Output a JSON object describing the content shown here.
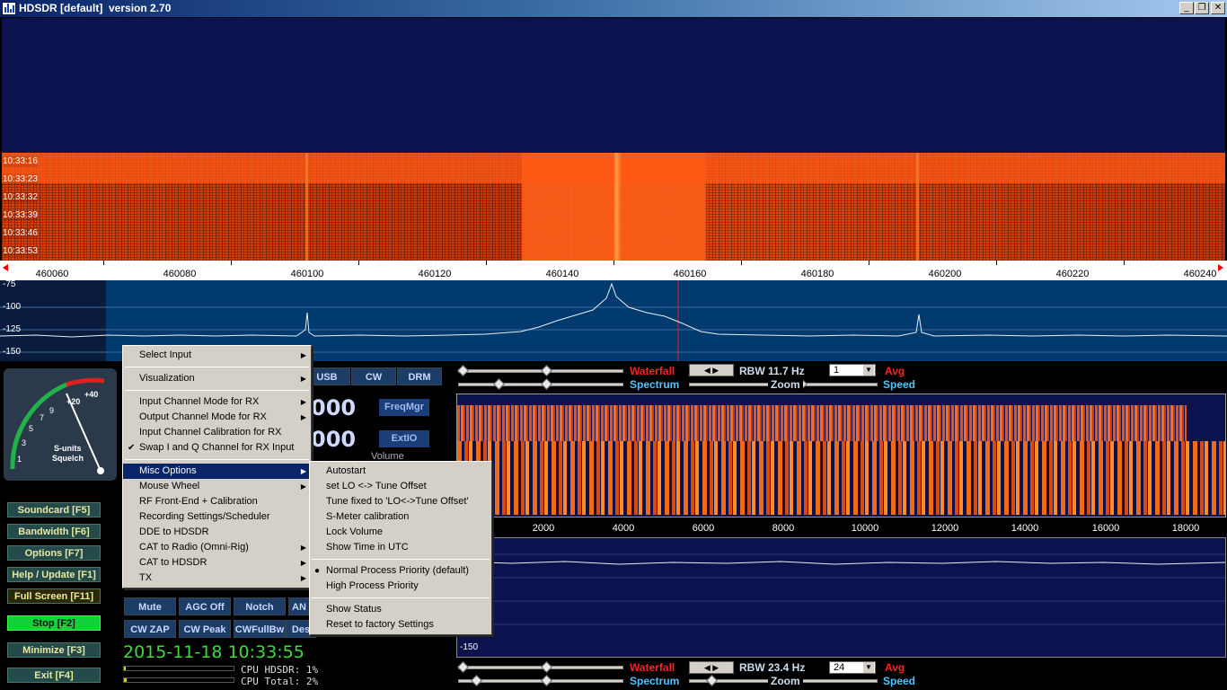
{
  "window": {
    "title": "HDSDR [default]  version 2.70",
    "min": "_",
    "restore": "❐",
    "close": "✕"
  },
  "waterfall_top": {
    "timestamps": [
      "10:33:16",
      "10:33:23",
      "10:33:32",
      "10:33:39",
      "10:33:46",
      "10:33:53"
    ]
  },
  "freq_scale": [
    "460060",
    "460080",
    "460100",
    "460120",
    "460140",
    "460160",
    "460180",
    "460200",
    "460220",
    "460240"
  ],
  "spectrum": {
    "db_labels": [
      "-75",
      "-100",
      "-125",
      "-150"
    ]
  },
  "smeter": {
    "label1": "S-units",
    "label2": "Squelch",
    "scale": [
      "1",
      "3",
      "5",
      "7",
      "9",
      "+20",
      "+40"
    ]
  },
  "left_buttons": {
    "soundcard": "Soundcard  [F5]",
    "bandwidth": "Bandwidth  [F6]",
    "options": "Options  [F7]",
    "help": "Help / Update  [F1]",
    "fullscreen": "Full Screen  [F11]",
    "stop": "Stop      [F2]",
    "minimize": "Minimize  [F3]",
    "exit": "Exit      [F4]"
  },
  "mode_buttons": {
    "usb": "USB",
    "cw": "CW",
    "drm": "DRM"
  },
  "digits": {
    "lo": "000",
    "tune": "000"
  },
  "side_buttons": {
    "freqmgr": "FreqMgr",
    "extio": "ExtIO",
    "volume": "Volume"
  },
  "dsp_buttons": {
    "mute": "Mute",
    "agc": "AGC Off",
    "notch": "Notch",
    "an": "AN",
    "cwzap": "CW ZAP",
    "cwpeak": "CW Peak",
    "cwfullbw": "CWFullBw",
    "des": "Des"
  },
  "status": {
    "clock": "2015-11-18 10:33:55",
    "cpu_hdsdr": "CPU HDSDR: 1%",
    "cpu_total": "CPU Total: 2%"
  },
  "top_controls": {
    "waterfall": "Waterfall",
    "rbw": "RBW 11.7 Hz",
    "avg_value": "1",
    "avg": "Avg",
    "spectrum": "Spectrum",
    "zoom": "Zoom",
    "speed": "Speed"
  },
  "bottom_controls": {
    "waterfall": "Waterfall",
    "rbw": "RBW 23.4 Hz",
    "avg_value": "24",
    "avg": "Avg",
    "spectrum": "Spectrum",
    "zoom": "Zoom",
    "speed": "Speed"
  },
  "audio_scale": [
    "2000",
    "4000",
    "6000",
    "8000",
    "10000",
    "12000",
    "14000",
    "16000",
    "18000"
  ],
  "audio_db_label": "-150",
  "main_menu": [
    {
      "label": "Select Input",
      "sub": true
    },
    {
      "sep": true
    },
    {
      "label": "Visualization",
      "sub": true
    },
    {
      "sep": true
    },
    {
      "label": "Input Channel Mode for RX",
      "sub": true
    },
    {
      "label": "Output Channel Mode for RX",
      "sub": true
    },
    {
      "label": "Input Channel Calibration for RX"
    },
    {
      "label": "Swap I and Q Channel for RX Input",
      "checked": true
    },
    {
      "sep": true
    },
    {
      "label": "Misc Options",
      "sub": true,
      "selected": true
    },
    {
      "label": "Mouse Wheel",
      "sub": true
    },
    {
      "label": "RF Front-End + Calibration"
    },
    {
      "label": "Recording Settings/Scheduler"
    },
    {
      "label": "DDE to HDSDR"
    },
    {
      "label": "CAT to Radio (Omni-Rig)",
      "sub": true
    },
    {
      "label": "CAT to HDSDR",
      "sub": true
    },
    {
      "label": "TX",
      "sub": true
    }
  ],
  "misc_menu": [
    {
      "label": "Autostart"
    },
    {
      "label": "set LO <-> Tune Offset"
    },
    {
      "label": "Tune fixed to 'LO<->Tune Offset'"
    },
    {
      "label": "S-Meter calibration"
    },
    {
      "label": "Lock Volume"
    },
    {
      "label": "Show Time in UTC"
    },
    {
      "sep": true
    },
    {
      "label": "Normal Process Priority (default)",
      "radio": true
    },
    {
      "label": "High Process Priority"
    },
    {
      "sep": true
    },
    {
      "label": "Show Status"
    },
    {
      "label": "Reset to factory Settings"
    }
  ],
  "colors": {
    "accent_red": "#ff2020",
    "accent_cyan": "#4cc4ff",
    "stop_green": "#13d13c",
    "clock_green": "#3ddc3d"
  }
}
